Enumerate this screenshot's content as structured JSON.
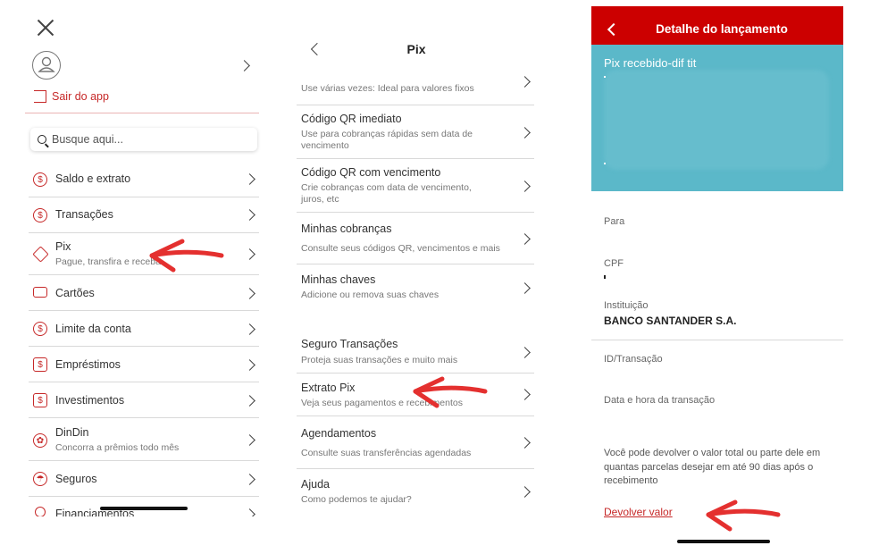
{
  "menu_panel": {
    "logout_label": "Sair do app",
    "search_placeholder": "Busque aqui...",
    "items": [
      {
        "label": "Saldo e extrato",
        "sub": ""
      },
      {
        "label": "Transações",
        "sub": ""
      },
      {
        "label": "Pix",
        "sub": "Pague, transfira e receba"
      },
      {
        "label": "Cartões",
        "sub": ""
      },
      {
        "label": "Limite da conta",
        "sub": ""
      },
      {
        "label": "Empréstimos",
        "sub": ""
      },
      {
        "label": "Investimentos",
        "sub": ""
      },
      {
        "label": "DinDin",
        "sub": "Concorra a prêmios todo mês"
      },
      {
        "label": "Seguros",
        "sub": ""
      },
      {
        "label": "Financiamentos",
        "sub": ""
      }
    ]
  },
  "pix_panel": {
    "title": "Pix",
    "top_partial_sub": "Use várias vezes: Ideal para valores fixos",
    "items": [
      {
        "label": "Código QR imediato",
        "sub": "Use para cobranças rápidas sem data de vencimento"
      },
      {
        "label": "Código QR com vencimento",
        "sub": "Crie cobranças com data de vencimento, juros, etc"
      },
      {
        "label": "Minhas cobranças",
        "sub": "Consulte seus códigos QR, vencimentos e mais"
      },
      {
        "label": "Minhas chaves",
        "sub": "Adicione ou remova suas chaves"
      },
      {
        "label": "Seguro Transações",
        "sub": "Proteja suas transações e muito mais"
      },
      {
        "label": "Extrato Pix",
        "sub": "Veja seus pagamentos e recebimentos"
      },
      {
        "label": "Agendamentos",
        "sub": "Consulte suas transferências agendadas"
      },
      {
        "label": "Ajuda",
        "sub": "Como podemos te ajudar?"
      }
    ]
  },
  "detail_panel": {
    "header_title": "Detalhe do lançamento",
    "transaction_type": "Pix recebido-dif tit",
    "labels": {
      "para": "Para",
      "cpf": "CPF",
      "instituicao": "Instituição",
      "id_transacao": "ID/Transação",
      "data_hora": "Data e hora da transação"
    },
    "instituicao_value": "BANCO SANTANDER S.A.",
    "note": "Você pode devolver o valor total ou parte dele em quantas parcelas desejar em até 90 dias após o recebimento",
    "return_link": "Devolver valor"
  },
  "colors": {
    "brand_red": "#cc0000",
    "annotation_red": "#e4302f",
    "teal": "#5bb8c9"
  }
}
